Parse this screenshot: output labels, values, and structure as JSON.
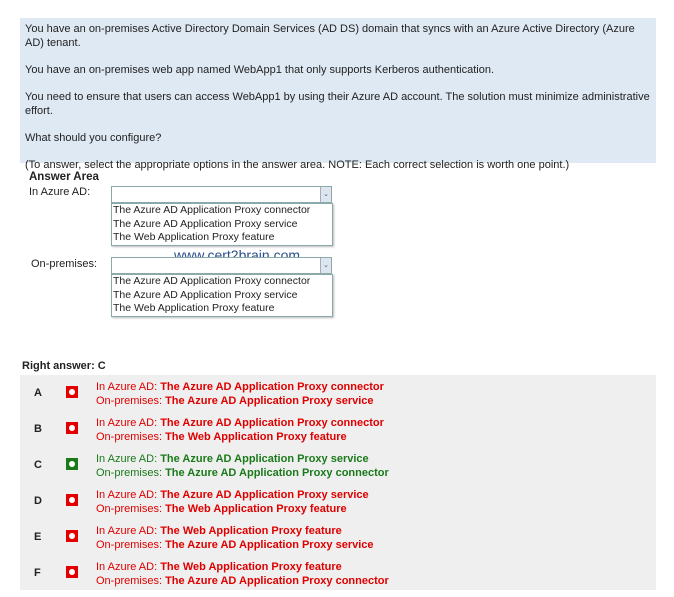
{
  "question": [
    "You have an on-premises Active Directory Domain Services (AD DS) domain that syncs with an Azure Active Directory (Azure AD) tenant.",
    "You have an on-premises web app named WebApp1 that only supports Kerberos authentication.",
    "You need to ensure that users can access WebApp1 by using their Azure AD account. The solution must minimize administrative effort.",
    "What should you configure?",
    "(To answer, select the appropriate options in the answer area. NOTE: Each correct selection is worth one point.)"
  ],
  "answer_area": {
    "title": "Answer Area",
    "azure_label": "In Azure AD:",
    "onprem_label": "On-premises:",
    "options": [
      "The Azure AD Application Proxy connector",
      "The Azure AD Application Proxy service",
      "The Web Application Proxy feature"
    ]
  },
  "watermark": "www.cert2brain.com",
  "right_answer": "Right answer: C",
  "colors": {
    "wrong": "#e00000",
    "right": "#1a7a1a"
  },
  "choices": [
    {
      "letter": "A",
      "azure": "The Azure AD Application Proxy connector",
      "onprem": "The Azure AD Application Proxy service",
      "correct": false
    },
    {
      "letter": "B",
      "azure": "The Azure AD Application Proxy connector",
      "onprem": "The Web Application Proxy feature",
      "correct": false
    },
    {
      "letter": "C",
      "azure": "The Azure AD Application Proxy service",
      "onprem": "The Azure AD Application Proxy connector",
      "correct": true
    },
    {
      "letter": "D",
      "azure": "The Azure AD Application Proxy service",
      "onprem": "The Web Application Proxy feature",
      "correct": false
    },
    {
      "letter": "E",
      "azure": "The Web Application Proxy feature",
      "onprem": "The Azure AD Application Proxy service",
      "correct": false
    },
    {
      "letter": "F",
      "azure": "The Web Application Proxy feature",
      "onprem": "The Azure AD Application Proxy connector",
      "correct": false
    }
  ],
  "prefix": {
    "azure": "In Azure AD: ",
    "onprem": "On-premises: "
  }
}
